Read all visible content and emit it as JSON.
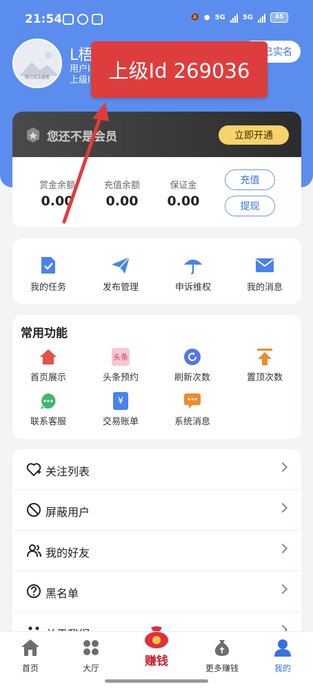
{
  "status": {
    "time": "21:54",
    "network1": "5G",
    "network2": "5G",
    "battery": "45"
  },
  "profile": {
    "name": "L梧",
    "line1": "用户I",
    "line2": "上级I",
    "avatar_text": "騎行无法避者",
    "verify": "已实名"
  },
  "overlay": {
    "text": "上级Id 269036"
  },
  "vip": {
    "text": "您还不是会员",
    "button": "立即开通",
    "balances": [
      {
        "label": "赏金余额",
        "value": "0.00"
      },
      {
        "label": "充值余额",
        "value": "0.00"
      },
      {
        "label": "保证金",
        "value": "0.00"
      }
    ],
    "recharge": "充值",
    "withdraw": "提现"
  },
  "quick": [
    {
      "label": "我的任务",
      "icon": "task-icon"
    },
    {
      "label": "发布管理",
      "icon": "send-icon"
    },
    {
      "label": "申诉维权",
      "icon": "umbrella-icon"
    },
    {
      "label": "我的消息",
      "icon": "mail-icon"
    }
  ],
  "functions": {
    "title": "常用功能",
    "items": [
      {
        "label": "首页展示",
        "icon": "home-icon"
      },
      {
        "label": "头条预约",
        "icon": "headline-icon",
        "icon_text": "头条"
      },
      {
        "label": "刷新次数",
        "icon": "refresh-icon"
      },
      {
        "label": "置顶次数",
        "icon": "pin-top-icon"
      },
      {
        "label": "联系客服",
        "icon": "chat-icon"
      },
      {
        "label": "交易账单",
        "icon": "bill-icon",
        "icon_text": "¥"
      },
      {
        "label": "系统消息",
        "icon": "message-icon"
      }
    ]
  },
  "list": [
    {
      "label": "关注列表",
      "icon": "heart-plus-icon"
    },
    {
      "label": "屏蔽用户",
      "icon": "block-icon"
    },
    {
      "label": "我的好友",
      "icon": "friends-icon"
    },
    {
      "label": "黑名单",
      "icon": "question-icon"
    },
    {
      "label": "关于我们",
      "icon": "about-icon"
    }
  ],
  "tabs": [
    {
      "label": "首页",
      "icon": "home-tab-icon"
    },
    {
      "label": "大厅",
      "icon": "grid-icon"
    },
    {
      "label": "赚钱",
      "icon": "money-bag-icon"
    },
    {
      "label": "更多赚钱",
      "icon": "money-sack-icon"
    },
    {
      "label": "我的",
      "icon": "user-icon"
    }
  ],
  "colors": {
    "primary": "#5b8def",
    "overlay": "#de3d3d",
    "vip_gold": "#f8d36a",
    "active_tab": "#3a6fe0"
  }
}
